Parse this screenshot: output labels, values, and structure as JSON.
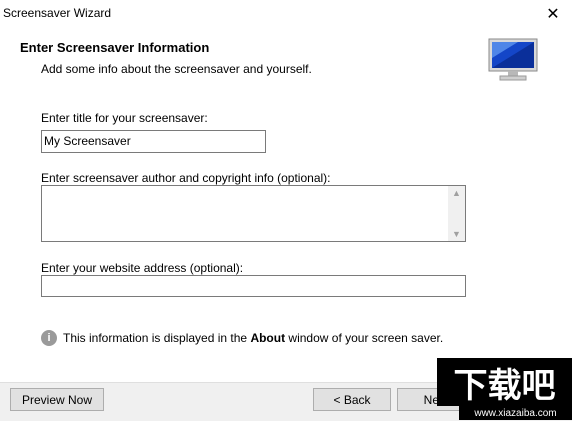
{
  "window": {
    "title": "Screensaver Wizard",
    "close_label": "✕"
  },
  "header": {
    "title": "Enter Screensaver Information",
    "subtitle": "Add some info about the screensaver and yourself.",
    "icon": "monitor-icon"
  },
  "form": {
    "title_label": "Enter title for your screensaver:",
    "title_value": "My Screensaver",
    "author_label": "Enter screensaver author and copyright info (optional):",
    "author_value": "",
    "website_label": "Enter your website address (optional):",
    "website_value": ""
  },
  "info": {
    "icon": "info-icon",
    "text_before": "This information is displayed in the ",
    "bold": "About",
    "text_after": " window of your screen saver."
  },
  "footer": {
    "preview_label": "Preview Now",
    "back_label": "< Back",
    "next_label": "Next"
  },
  "watermark": {
    "text": "下载吧",
    "url": "www.xiazaiba.com"
  }
}
